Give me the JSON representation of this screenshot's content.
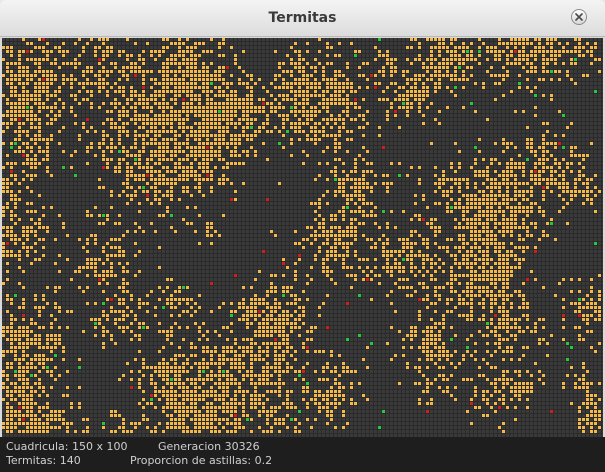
{
  "window": {
    "title": "Termitas"
  },
  "status": {
    "grid_label": "Cuadricula: 150 x 100",
    "generation_label": "Generacion 30326",
    "termites_label": "Termitas: 140",
    "proportion_label": "Proporcion de astillas: 0.2"
  },
  "simulation": {
    "grid_cols": 150,
    "grid_rows": 100,
    "termite_count": 140,
    "chip_proportion": 0.2,
    "generation": 30326,
    "colors": {
      "background": "#2a2a2a",
      "empty_cell": "#3a3a3a",
      "wood_chip": "#f5b94a",
      "termite_empty": "#28c83c",
      "termite_carrying": "#d21e1e"
    }
  }
}
